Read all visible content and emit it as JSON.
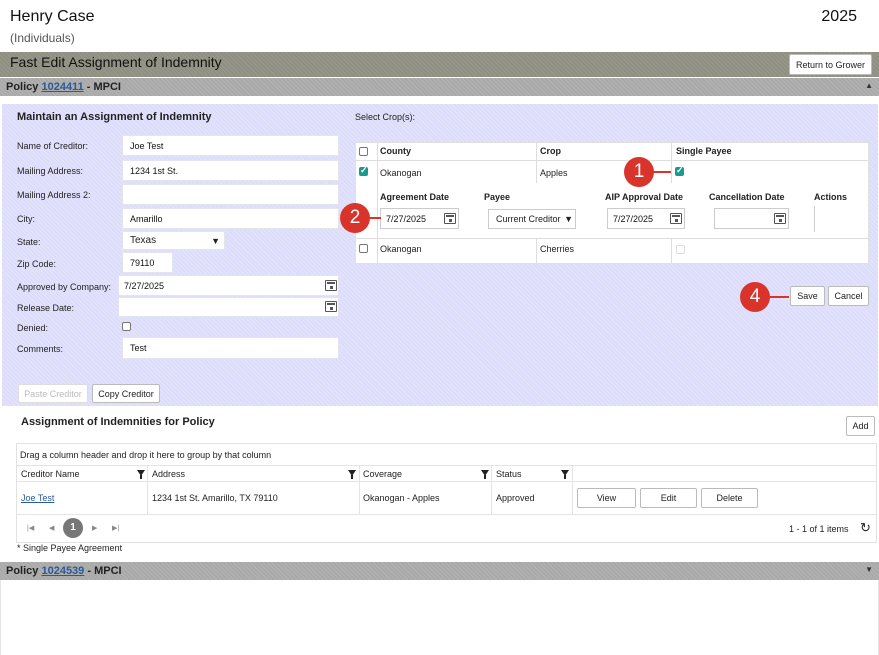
{
  "header": {
    "name": "Henry Case",
    "sub": "(Individuals)",
    "year": "2025"
  },
  "title": "Fast Edit Assignment of Indemnity",
  "return_btn": "Return to Grower",
  "policy1": {
    "prefix": "Policy ",
    "number": "1024411",
    "suffix": " - MPCI"
  },
  "policy2": {
    "prefix": "Policy ",
    "number": "1024539",
    "suffix": " - MPCI"
  },
  "form": {
    "heading": "Maintain an Assignment of Indemnity",
    "name_label": "Name of Creditor:",
    "name_value": "Joe Test",
    "addr_label": "Mailing Address:",
    "addr_value": "1234 1st St.",
    "addr2_label": "Mailing Address 2:",
    "addr2_value": "",
    "city_label": "City:",
    "city_value": "Amarillo",
    "state_label": "State:",
    "state_value": "Texas",
    "zip_label": "Zip Code:",
    "zip_value": "79110",
    "approved_label": "Approved by Company:",
    "approved_value": "7/27/2025",
    "release_label": "Release Date:",
    "release_value": "",
    "denied_label": "Denied:",
    "comments_label": "Comments:",
    "comments_value": "Test",
    "paste_btn": "Paste Creditor",
    "copy_btn": "Copy Creditor"
  },
  "crops": {
    "select_label": "Select Crop(s):",
    "headers": {
      "county": "County",
      "crop": "Crop",
      "single": "Single Payee"
    },
    "row1": {
      "county": "Okanogan",
      "crop": "Apples"
    },
    "row2": {
      "county": "Okanogan",
      "crop": "Cherries"
    },
    "sub_headers": {
      "agreement": "Agreement Date",
      "payee": "Payee",
      "aip": "AIP Approval Date",
      "cancel": "Cancellation Date",
      "actions": "Actions"
    },
    "agreement_value": "7/27/2025",
    "payee_value": "Current Creditor",
    "aip_value": "7/27/2025",
    "cancel_value": ""
  },
  "save_btn": "Save",
  "cancel_btn": "Cancel",
  "badges": {
    "b1": "1",
    "b2": "2",
    "b4": "4"
  },
  "assignments": {
    "heading": "Assignment of Indemnities for Policy",
    "add_btn": "Add",
    "group_hint": "Drag a column header and drop it here to group by that column",
    "cols": {
      "creditor": "Creditor Name",
      "address": "Address",
      "coverage": "Coverage",
      "status": "Status"
    },
    "row": {
      "creditor": "Joe Test",
      "address": "1234 1st St. Amarillo, TX 79110",
      "coverage": "Okanogan - Apples",
      "status": "Approved"
    },
    "view_btn": "View",
    "edit_btn": "Edit",
    "delete_btn": "Delete",
    "page": "1",
    "items": "1 - 1 of 1 items",
    "footnote": "* Single Payee Agreement"
  }
}
